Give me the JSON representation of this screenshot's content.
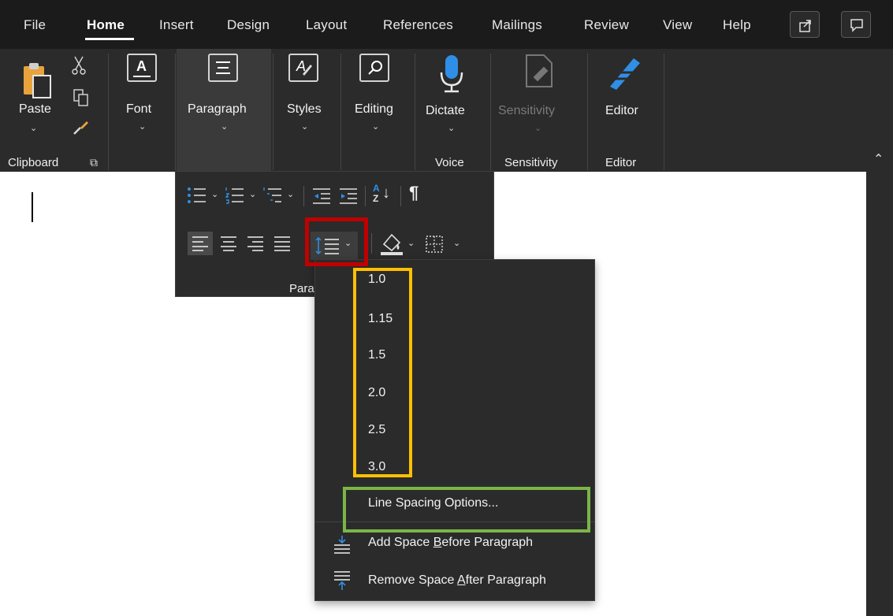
{
  "tabs": [
    "File",
    "Home",
    "Insert",
    "Design",
    "Layout",
    "References",
    "Mailings",
    "Review",
    "View",
    "Help"
  ],
  "active_tab": "Home",
  "ribbon": {
    "paste_label": "Paste",
    "font_label": "Font",
    "paragraph_label": "Paragraph",
    "styles_label": "Styles",
    "editing_label": "Editing",
    "dictate_label": "Dictate",
    "sensitivity_label": "Sensitivity",
    "editor_label": "Editor",
    "groups": {
      "clipboard": "Clipboard",
      "voice": "Voice",
      "sensitivity": "Sensitivity",
      "editor": "Editor"
    }
  },
  "paragraph_popup": {
    "group_label": "Para"
  },
  "line_spacing_menu": {
    "values": [
      "1.0",
      "1.15",
      "1.5",
      "2.0",
      "2.5",
      "3.0"
    ],
    "options_label": "Line Spacing Options...",
    "add_before": {
      "pre": "Add Space ",
      "u": "B",
      "post": "efore Paragraph"
    },
    "remove_after": {
      "pre": "Remove Space ",
      "u": "A",
      "post": "fter Paragraph"
    }
  },
  "colors": {
    "tab_bar": "#1b1b1b",
    "ribbon": "#2b2b2b",
    "annotation_red": "#c00000",
    "annotation_yellow": "#ffc000",
    "annotation_green": "#7ab648",
    "accent_blue": "#2f8fe6"
  },
  "icons": [
    "share-icon",
    "comment-icon",
    "paste-icon",
    "cut-icon",
    "copy-icon",
    "format-painter-icon",
    "font-icon",
    "paragraph-icon",
    "styles-icon",
    "editing-icon",
    "dictate-icon",
    "sensitivity-icon",
    "editor-icon",
    "collapse-ribbon-icon",
    "bullets-icon",
    "numbering-icon",
    "multilevel-list-icon",
    "decrease-indent-icon",
    "increase-indent-icon",
    "sort-icon",
    "pilcrow-icon",
    "align-left-icon",
    "align-center-icon",
    "align-right-icon",
    "justify-icon",
    "line-spacing-icon",
    "shading-icon",
    "borders-icon",
    "add-space-before-icon",
    "remove-space-after-icon"
  ]
}
